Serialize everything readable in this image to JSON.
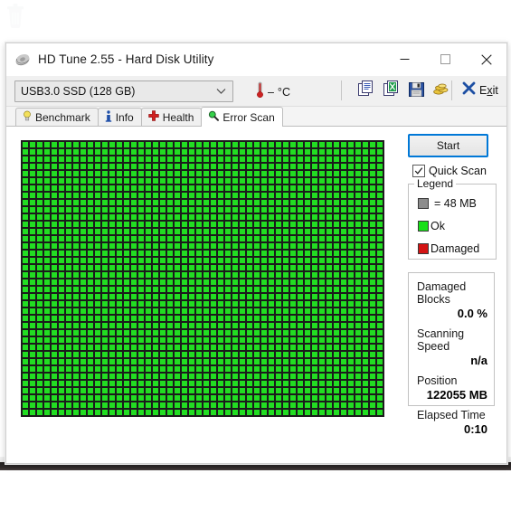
{
  "desktop": {
    "icon_name": "recycle-bin-icon"
  },
  "window": {
    "title": "HD Tune 2.55 - Hard Disk Utility",
    "icon_name": "hdtune-disk-icon",
    "minimize_label": "Minimize",
    "maximize_label": "Maximize",
    "close_label": "Close"
  },
  "toolbar": {
    "drive": {
      "selected": "USB3.0  SSD (128 GB)",
      "options": [
        "USB3.0  SSD (128 GB)"
      ]
    },
    "temperature": "–  °C",
    "icons": [
      {
        "name": "copy-icon",
        "label": "Copy"
      },
      {
        "name": "copy-to-excel-icon",
        "label": "Copy to Excel"
      },
      {
        "name": "save-icon",
        "label": "Save"
      },
      {
        "name": "gold-coins-icon",
        "label": "Donate"
      }
    ],
    "exit_label": "Exit",
    "exit_accel": "x"
  },
  "tabs": [
    {
      "id": "benchmark",
      "label": "Benchmark",
      "icon": "lightbulb-icon",
      "active": false
    },
    {
      "id": "info",
      "label": "Info",
      "icon": "info-icon",
      "active": false
    },
    {
      "id": "health",
      "label": "Health",
      "icon": "red-cross-icon",
      "active": false
    },
    {
      "id": "error-scan",
      "label": "Error Scan",
      "icon": "magnifier-icon",
      "active": true
    }
  ],
  "scan": {
    "start_button": "Start",
    "quick_scan_label": "Quick Scan",
    "quick_scan_checked": true,
    "grid": {
      "columns": 50,
      "rows": 38,
      "block_size_mb": 48,
      "all_ok": true
    }
  },
  "legend": {
    "title": "Legend",
    "items": [
      {
        "swatch": "grey",
        "label": "= 48 MB",
        "color": "#8c8c8c"
      },
      {
        "swatch": "green",
        "label": "Ok",
        "color": "#18e018"
      },
      {
        "swatch": "red",
        "label": "Damaged",
        "color": "#d41414"
      }
    ]
  },
  "stats": [
    {
      "label": "Damaged Blocks",
      "value": "0.0 %"
    },
    {
      "label": "Scanning Speed",
      "value": "n/a"
    },
    {
      "label": "Position",
      "value": "122055 MB"
    },
    {
      "label": "Elapsed Time",
      "value": "0:10"
    }
  ]
}
